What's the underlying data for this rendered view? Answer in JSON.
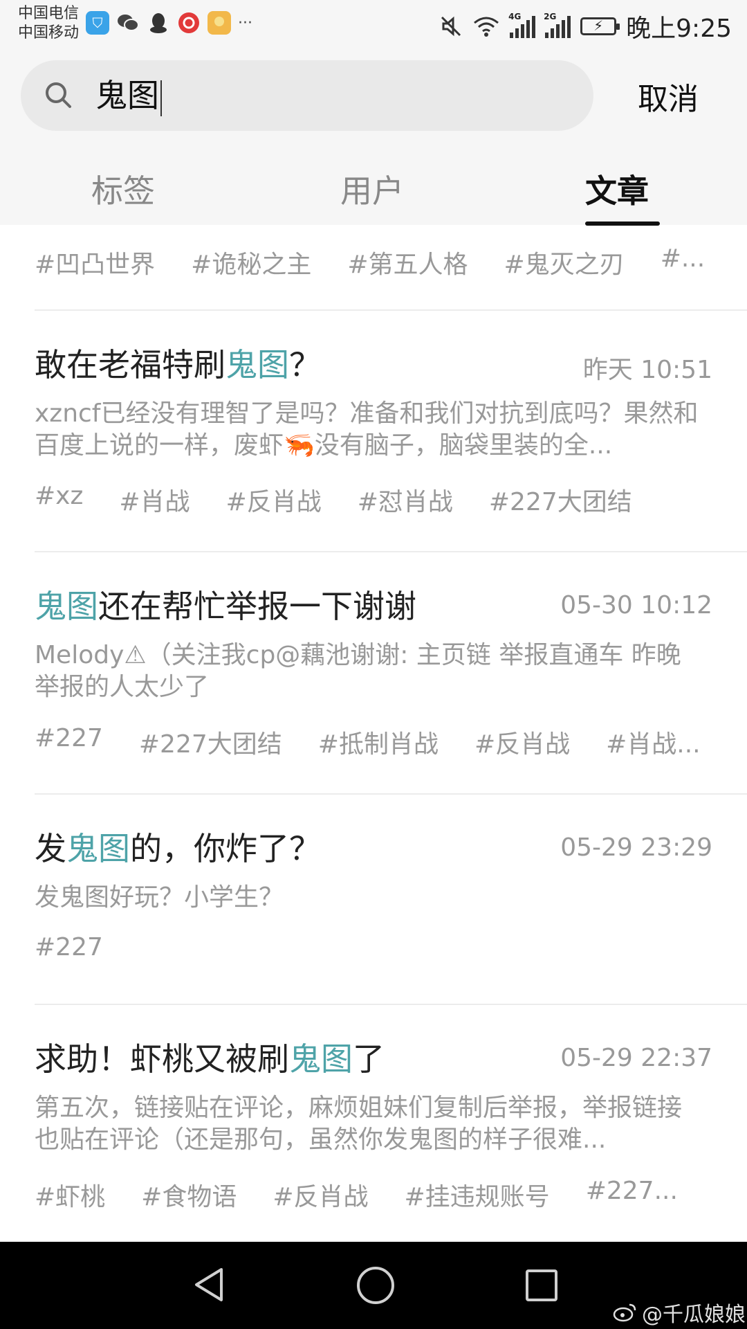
{
  "status_bar": {
    "carrier_1": "中国电信",
    "carrier_2": "中国移动",
    "more": "···",
    "signal_1_label": "4G",
    "signal_2_label": "2G",
    "time": "晚上9:25"
  },
  "search": {
    "query": "鬼图",
    "cancel_label": "取消"
  },
  "tabs": [
    {
      "label": "标签",
      "active": false
    },
    {
      "label": "用户",
      "active": false
    },
    {
      "label": "文章",
      "active": true
    }
  ],
  "top_tags": [
    "#凹凸世界",
    "#诡秘之主",
    "#第五人格",
    "#鬼灭之刃",
    "#..."
  ],
  "articles": [
    {
      "title_pre": "敢在老福特刷",
      "title_highlight": "鬼图",
      "title_post": "？",
      "time": "昨天 10:51",
      "excerpt": "xzncf已经没有理智了是吗？准备和我们对抗到底吗？果然和百度上说的一样，废虾🦐没有脑子，脑袋里装的全...",
      "tags": [
        "#xz",
        "#肖战",
        "#反肖战",
        "#怼肖战",
        "#227大团结"
      ]
    },
    {
      "title_pre": "",
      "title_highlight": "鬼图",
      "title_post": "还在帮忙举报一下谢谢",
      "time": "05-30 10:12",
      "excerpt": "Melody⚠（关注我cp@藕池谢谢: 主页链 举报直通车 昨晚举报的人太少了",
      "tags": [
        "#227",
        "#227大团结",
        "#抵制肖战",
        "#反肖战",
        "#肖战..."
      ]
    },
    {
      "title_pre": "发",
      "title_highlight": "鬼图",
      "title_post": "的，你炸了？",
      "time": "05-29 23:29",
      "excerpt": "发鬼图好玩？小学生？",
      "tags": [
        "#227"
      ]
    },
    {
      "title_pre": "求助！虾桃又被刷",
      "title_highlight": "鬼图",
      "title_post": "了",
      "time": "05-29 22:37",
      "excerpt": "第五次，链接贴在评论，麻烦姐妹们复制后举报，举报链接也贴在评论（还是那句，虽然你发鬼图的样子很难...",
      "tags": [
        "#虾桃",
        "#食物语",
        "#反肖战",
        "#挂违规账号",
        "#227..."
      ]
    }
  ],
  "watermark": "@千瓜娘娘",
  "colors": {
    "highlight": "#4ea3a8",
    "muted": "#999999",
    "header_bg": "#f6f6f6"
  }
}
